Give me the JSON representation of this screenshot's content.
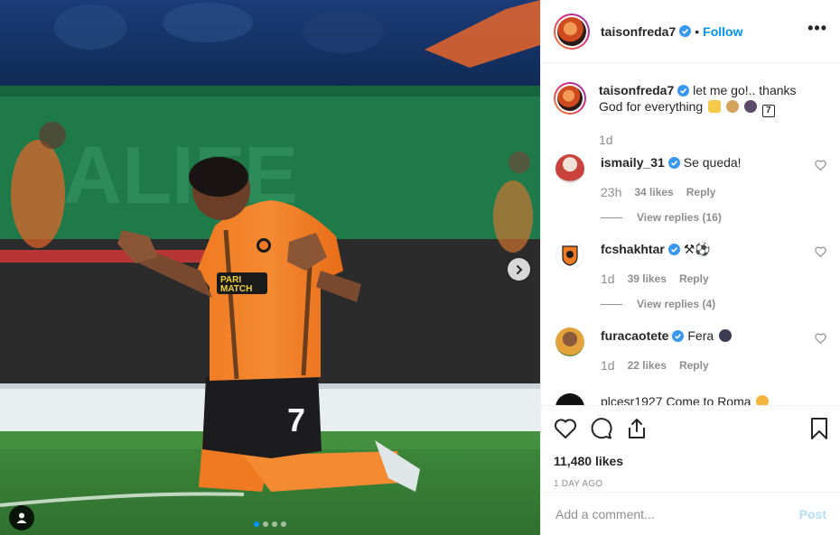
{
  "post": {
    "author": "taisonfreda7",
    "follow_separator": "•",
    "follow_label": "Follow",
    "more_icon": "more-horizontal-icon",
    "carousel": {
      "count": 4,
      "active_index": 0
    },
    "caption": {
      "username": "taisonfreda7",
      "text": "let me go!.. thanks God for everything",
      "emoji_number": "7",
      "time": "1d"
    }
  },
  "comments": [
    {
      "username": "ismaily_31",
      "text": "Se queda!",
      "time": "23h",
      "likes": "34 likes",
      "reply_label": "Reply",
      "view_replies": "View replies (16)"
    },
    {
      "username": "fcshakhtar",
      "text": "⚒⚽",
      "time": "1d",
      "likes": "39 likes",
      "reply_label": "Reply",
      "view_replies": "View replies (4)"
    },
    {
      "username": "furacaotete",
      "text": "Fera",
      "time": "1d",
      "likes": "22 likes",
      "reply_label": "Reply"
    },
    {
      "username": "plcesr1927",
      "text": "Come to Roma",
      "time": "",
      "likes": "",
      "reply_label": ""
    }
  ],
  "stats": {
    "likes": "11,480 likes",
    "date": "1 DAY AGO"
  },
  "add_comment": {
    "placeholder": "Add a comment...",
    "post_label": "Post"
  },
  "colors": {
    "accent": "#0095f6",
    "muted": "#8e8e8e",
    "jersey_orange": "#f07a22"
  }
}
